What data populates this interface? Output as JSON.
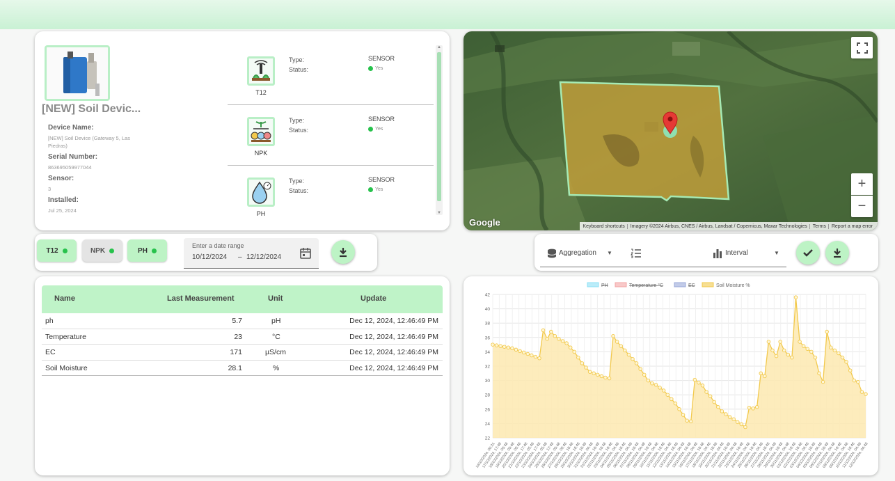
{
  "device": {
    "title": "[NEW] Soil Devic...",
    "fields": [
      {
        "label": "Device Name:",
        "value": "[NEW] Soil Device (Gateway 5, Las Piedras)"
      },
      {
        "label": "Serial Number:",
        "value": "863695059977044"
      },
      {
        "label": "Sensor:",
        "value": "3"
      },
      {
        "label": "Installed:",
        "value": "Jul 25, 2024"
      }
    ],
    "sensors": [
      {
        "name": "T12",
        "type_label": "Type:",
        "status_label": "Status:",
        "type": "SENSOR",
        "status": "Yes",
        "icon": "irrigation-sensor-icon"
      },
      {
        "name": "NPK",
        "type_label": "Type:",
        "status_label": "Status:",
        "type": "SENSOR",
        "status": "Yes",
        "icon": "npk-sensor-icon"
      },
      {
        "name": "PH",
        "type_label": "Type:",
        "status_label": "Status:",
        "type": "SENSOR",
        "status": "Yes",
        "icon": "ph-drop-icon"
      }
    ]
  },
  "map": {
    "google_label": "Google",
    "footer": [
      "Keyboard shortcuts",
      "Imagery ©2024 Airbus, CNES / Airbus, Landsat / Copernicus, Maxar Technologies",
      "Terms",
      "Report a map error"
    ],
    "zoom_in": "+",
    "zoom_out": "−",
    "fullscreen_icon": "fullscreen-icon",
    "marker_icon": "map-pin-icon"
  },
  "filters": {
    "chips": [
      {
        "label": "T12",
        "active": true
      },
      {
        "label": "NPK",
        "active": false
      },
      {
        "label": "PH",
        "active": true
      }
    ],
    "date_range": {
      "label": "Enter a date range",
      "start": "10/12/2024",
      "separator": "–",
      "end": "12/12/2024"
    },
    "download_icon": "download-icon"
  },
  "controls": {
    "aggregation": "Aggregation",
    "interval": "Interval",
    "confirm_icon": "check-icon",
    "download_icon": "download-icon"
  },
  "table": {
    "headers": [
      "Name",
      "Last Measurement",
      "Unit",
      "Update"
    ],
    "rows": [
      {
        "name": "ph",
        "value": "5.7",
        "unit": "pH",
        "update": "Dec 12, 2024, 12:46:49 PM"
      },
      {
        "name": "Temperature",
        "value": "23",
        "unit": "°C",
        "update": "Dec 12, 2024, 12:46:49 PM"
      },
      {
        "name": "EC",
        "value": "171",
        "unit": "µS/cm",
        "update": "Dec 12, 2024, 12:46:49 PM"
      },
      {
        "name": "Soil Moisture",
        "value": "28.1",
        "unit": "%",
        "update": "Dec 12, 2024, 12:46:49 PM"
      }
    ]
  },
  "colors": {
    "accent": "#bdf3c5",
    "status_dot": "#27c24c",
    "moisture_line": "#f2c94c",
    "moisture_fill": "#fde9b0",
    "polygon_fill": "#c9a23a"
  },
  "chart_data": {
    "type": "area",
    "legend": [
      {
        "name": "PH",
        "hidden": true,
        "color": "#8ee0f5"
      },
      {
        "name": "Temperature °C",
        "hidden": true,
        "color": "#f3a5a5"
      },
      {
        "name": "EC",
        "hidden": true,
        "color": "#9aa8d8"
      },
      {
        "name": "Soil Moisture %",
        "hidden": false,
        "color": "#f2c94c"
      }
    ],
    "ylim": [
      22,
      42
    ],
    "yticks": [
      22,
      24,
      26,
      28,
      30,
      32,
      34,
      36,
      38,
      40,
      42
    ],
    "x_labels": [
      "14/10/2024, 00:31",
      "17/10/2024, 17:48",
      "18/10/2024, 05:48",
      "19/10/2024, 05:48",
      "20/10/2024, 05:48",
      "21/10/2024, 17:48",
      "22/10/2024, 05:48",
      "23/10/2024, 17:48",
      "24/10/2024, 05:48",
      "25/10/2024, 17:48",
      "26/10/2024, 05:48",
      "27/10/2024, 05:48",
      "28/10/2024, 16:48",
      "29/10/2024, 16:48",
      "30/10/2024, 16:48",
      "31/10/2024, 04:48",
      "01/11/2024, 16:48",
      "02/11/2024, 16:48",
      "03/11/2024, 16:48",
      "04/11/2024, 04:48",
      "05/11/2024, 16:48",
      "06/11/2024, 04:48",
      "07/11/2024, 16:48",
      "08/11/2024, 04:48",
      "09/11/2024, 16:48",
      "10/11/2024, 04:48",
      "11/11/2024, 16:48",
      "12/11/2024, 04:48",
      "13/11/2024, 16:48",
      "14/11/2024, 04:48",
      "15/11/2024, 16:48",
      "16/11/2024, 04:48",
      "17/11/2024, 16:48",
      "18/11/2024, 04:48",
      "19/11/2024, 16:48",
      "20/11/2024, 04:48",
      "21/11/2024, 16:48",
      "22/11/2024, 04:48",
      "23/11/2024, 16:48",
      "24/11/2024, 04:48",
      "25/11/2024, 16:48",
      "26/11/2024, 04:48",
      "27/11/2024, 16:48",
      "28/11/2024, 04:48",
      "29/11/2024, 16:48",
      "30/11/2024, 04:48",
      "01/12/2024, 16:48",
      "02/12/2024, 16:48",
      "03/12/2024, 04:48",
      "04/12/2024, 16:48",
      "05/12/2024, 04:48",
      "06/12/2024, 16:48",
      "07/12/2024, 04:48",
      "08/12/2024, 16:48",
      "09/12/2024, 04:48",
      "10/12/2024, 16:48",
      "11/12/2024, 04:48",
      "12/12/2024, 04:48"
    ],
    "series": [
      {
        "name": "Soil Moisture %",
        "values": [
          35.0,
          34.9,
          34.8,
          34.7,
          34.6,
          34.5,
          34.3,
          34.1,
          33.9,
          33.7,
          33.5,
          33.3,
          33.1,
          37.0,
          35.8,
          36.8,
          36.2,
          35.8,
          35.5,
          35.2,
          34.6,
          34.0,
          33.2,
          32.4,
          31.8,
          31.2,
          31.0,
          30.8,
          30.6,
          30.4,
          30.3,
          36.2,
          35.4,
          34.8,
          34.2,
          33.6,
          33.0,
          32.4,
          31.6,
          30.8,
          30.0,
          29.6,
          29.4,
          29.0,
          28.6,
          28.0,
          27.4,
          26.8,
          26.0,
          25.2,
          24.4,
          24.3,
          30.1,
          29.7,
          29.3,
          28.4,
          27.8,
          27.0,
          26.3,
          25.7,
          25.3,
          24.9,
          24.6,
          24.2,
          23.9,
          23.5,
          26.2,
          26.1,
          26.3,
          31.0,
          30.6,
          35.4,
          34.2,
          33.4,
          35.4,
          34.2,
          33.6,
          33.2,
          41.6,
          35.4,
          34.8,
          34.4,
          34.0,
          33.2,
          31.0,
          29.8,
          36.8,
          34.6,
          34.2,
          33.8,
          33.2,
          32.6,
          31.4,
          30.0,
          29.8,
          28.4,
          28.1
        ]
      }
    ]
  }
}
